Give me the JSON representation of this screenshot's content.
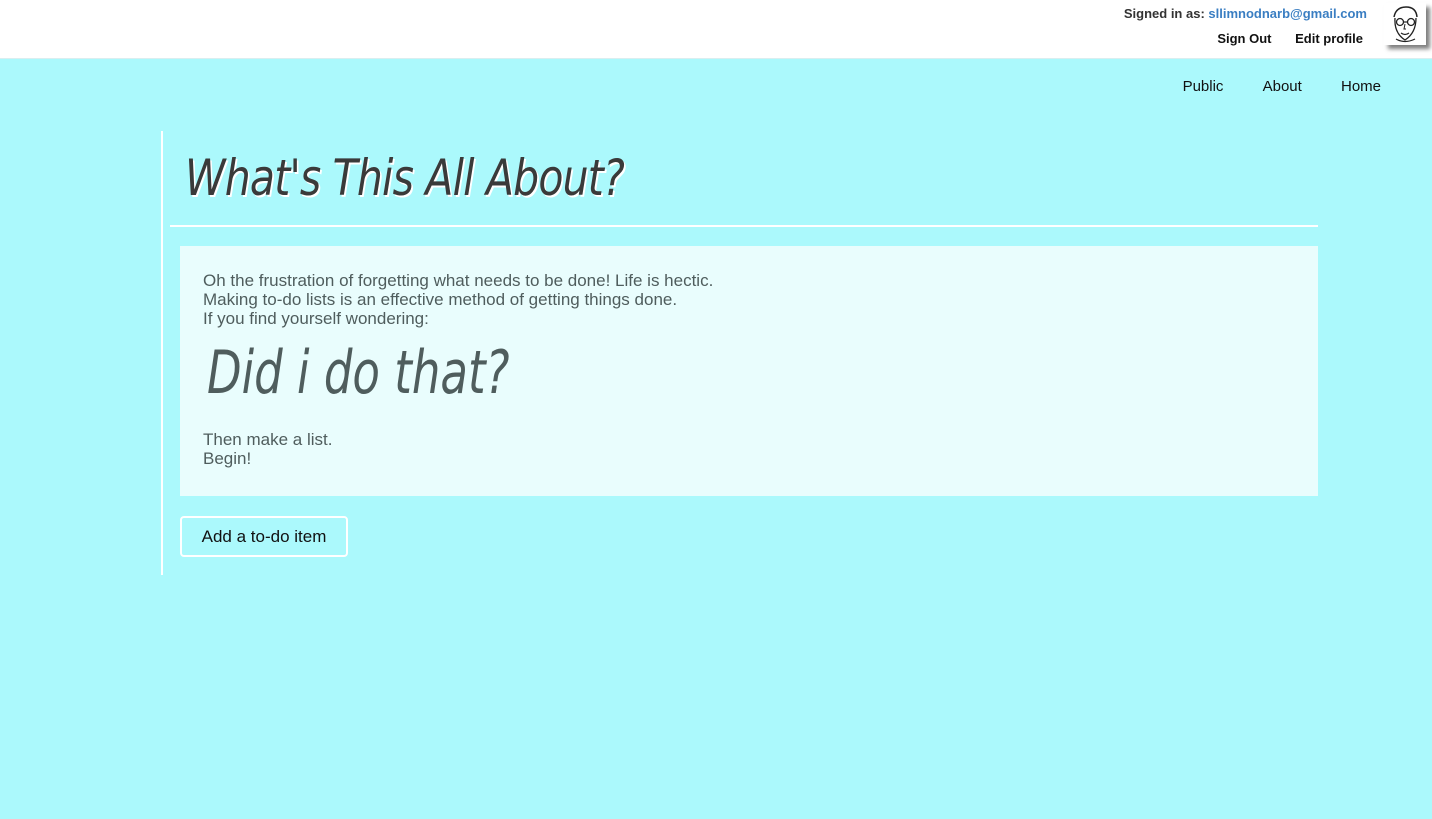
{
  "header": {
    "signed_in_label": "Signed in as:",
    "user_email": "sllimnodnarb@gmail.com",
    "sign_out": "Sign Out",
    "edit_profile": "Edit profile"
  },
  "nav": {
    "items": [
      "Public",
      "About",
      "Home"
    ]
  },
  "main": {
    "title": "What's This All About?",
    "intro": {
      "lines": [
        "Oh the frustration of forgetting what needs to be done! Life is hectic.",
        "Making to-do lists is an effective method of getting things done.",
        "If you find yourself wondering:"
      ],
      "heading": "Did i do that?",
      "closing": [
        "Then make a list.",
        "Begin!"
      ]
    },
    "add_button": "Add a to-do item"
  },
  "colors": {
    "background": "#abf9fc",
    "header_bg": "#ffffff",
    "email_link": "#3a7ec2",
    "intro_box_bg": "#e9fdfd",
    "intro_text": "#4f5d5d"
  }
}
